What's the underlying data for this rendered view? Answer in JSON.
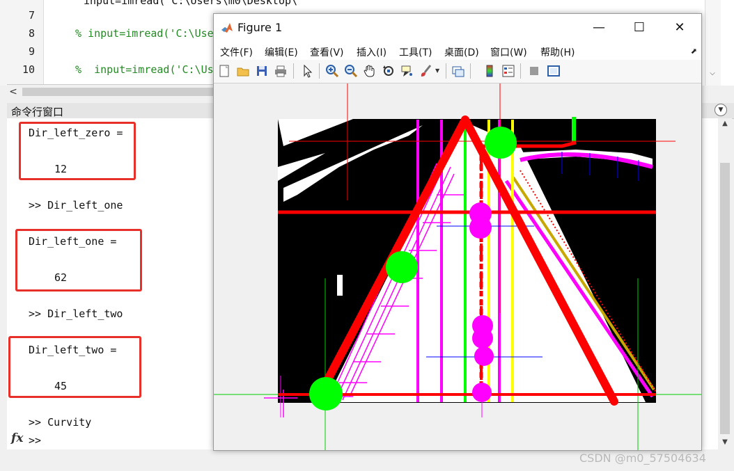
{
  "editor": {
    "lines": [
      {
        "num": "7",
        "code": "input=imread('C:\\Users\\m0\\Desktop\\",
        "color": "#111111"
      },
      {
        "num": "8",
        "code": "% input=imread('C:\\Use"
      },
      {
        "num": "9",
        "code": ""
      },
      {
        "num": "10",
        "code": "%  input=imread('C:\\Us"
      }
    ]
  },
  "command_window": {
    "title": "命令行窗口",
    "lines": [
      "Dir_left_zero =",
      "12",
      ">> Dir_left_one",
      "Dir_left_one =",
      "62",
      ">> Dir_left_two",
      "Dir_left_two =",
      "45",
      ">> Curvity",
      ">>"
    ],
    "fx_label": "fx"
  },
  "figure": {
    "title": "Figure 1",
    "menu": [
      "文件(F)",
      "编辑(E)",
      "查看(V)",
      "插入(I)",
      "工具(T)",
      "桌面(D)",
      "窗口(W)",
      "帮助(H)"
    ],
    "toolbar": [
      "new-figure",
      "open-file",
      "save",
      "print",
      "select-arrow",
      "zoom-in",
      "zoom-out",
      "pan",
      "rotate-3d",
      "data-cursor",
      "brush",
      "link",
      "colorbar",
      "legend",
      "hide-plot-tools",
      "show-plot-tools"
    ],
    "colors": {
      "red": "#ff0000",
      "magenta": "#ff00ff",
      "green": "#00ff00",
      "yellow": "#ffff00",
      "blue": "#0000ff"
    }
  },
  "watermark": "CSDN @m0_57504634"
}
